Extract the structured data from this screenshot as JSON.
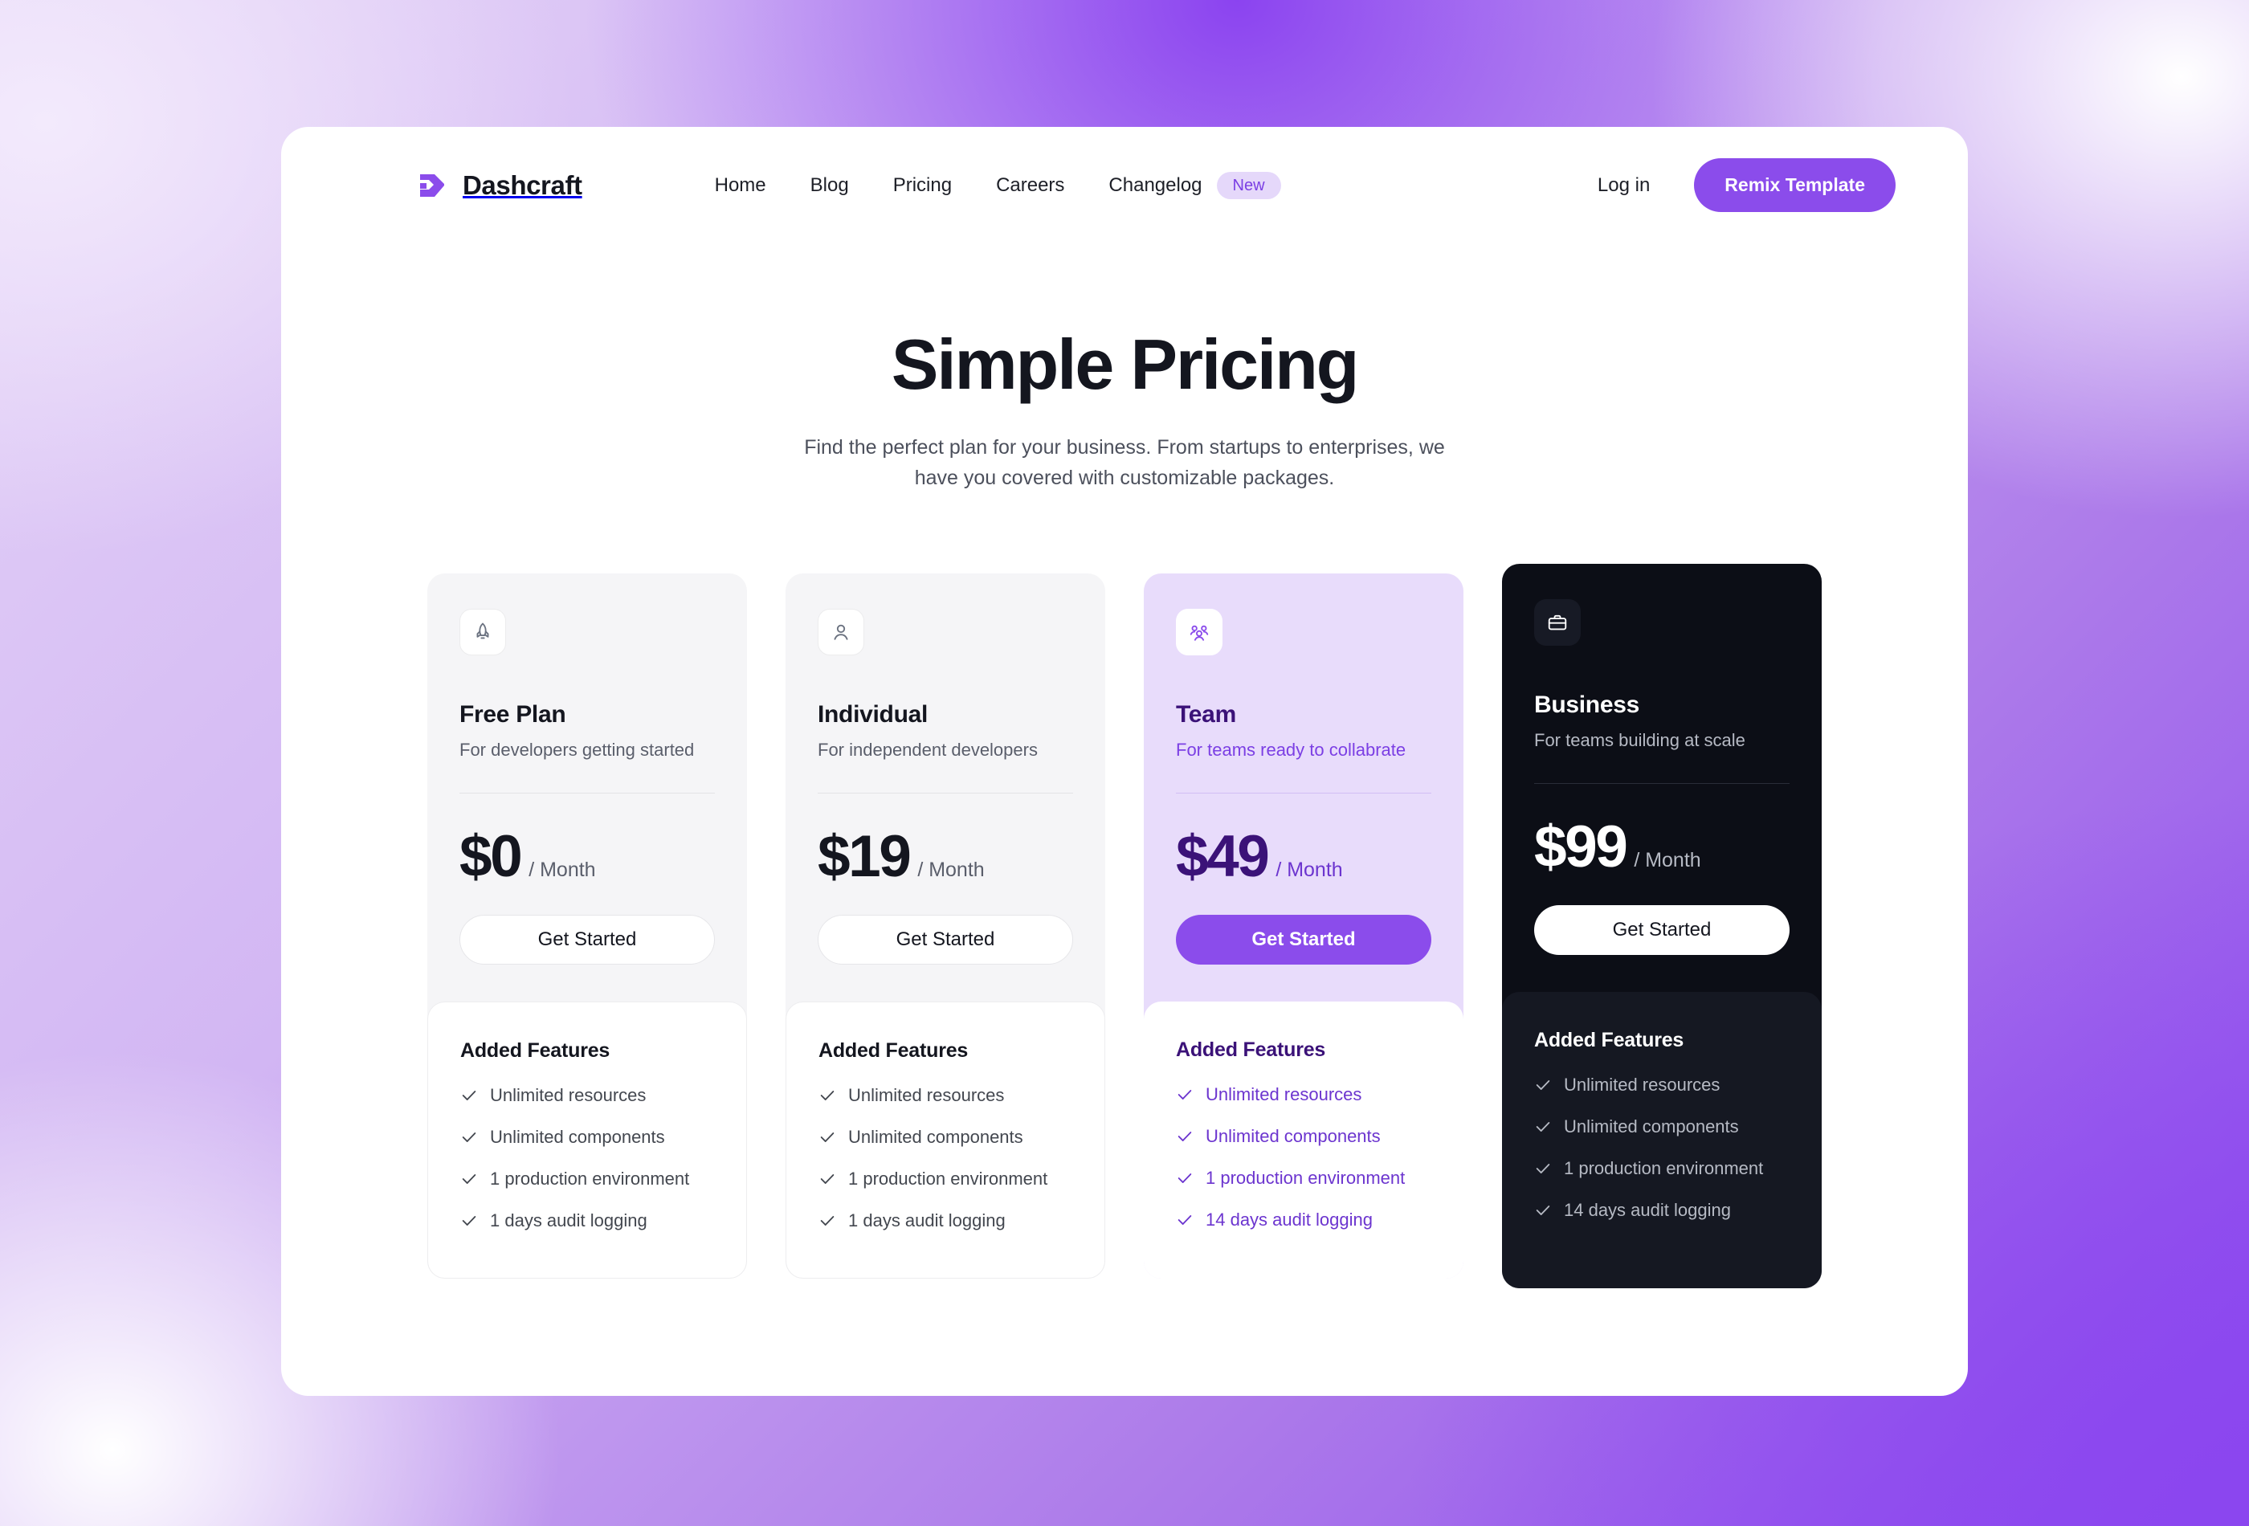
{
  "theme": {
    "brand_purple": "#8b4ceb",
    "accent_bg": "#e8dcfb",
    "dark_bg": "#0c0e16",
    "deep_purple_text": "#3b1278"
  },
  "navbar": {
    "logo_icon": "dashcraft-logo-icon",
    "brand_name": "Dashcraft",
    "links": [
      {
        "label": "Home"
      },
      {
        "label": "Blog"
      },
      {
        "label": "Pricing"
      },
      {
        "label": "Careers"
      }
    ],
    "changelog": {
      "label": "Changelog",
      "badge": "New"
    },
    "login_label": "Log in",
    "cta_label": "Remix Template"
  },
  "hero": {
    "title": "Simple Pricing",
    "subtitle": "Find the perfect plan for your business. From startups to enterprises, we have you covered with customizable packages."
  },
  "pricing": {
    "features_heading": "Added Features",
    "cta_label": "Get Started",
    "period_label": "/ Month",
    "plans": [
      {
        "icon": "rocket-icon",
        "name": "Free Plan",
        "description": "For developers getting started",
        "price": "$0",
        "period": "/ Month",
        "cta": "Get Started",
        "features_heading": "Added Features",
        "features": [
          "Unlimited resources",
          "Unlimited components",
          "1 production environment",
          "1 days audit logging"
        ]
      },
      {
        "icon": "user-icon",
        "name": "Individual",
        "description": "For independent developers",
        "price": "$19",
        "period": "/ Month",
        "cta": "Get Started",
        "features_heading": "Added Features",
        "features": [
          "Unlimited resources",
          "Unlimited components",
          "1 production environment",
          "1 days audit logging"
        ]
      },
      {
        "icon": "users-group-icon",
        "name": "Team",
        "description": "For teams ready to collabrate",
        "price": "$49",
        "period": "/ Month",
        "cta": "Get Started",
        "features_heading": "Added Features",
        "features": [
          "Unlimited resources",
          "Unlimited components",
          "1 production environment",
          "14 days audit logging"
        ]
      },
      {
        "icon": "briefcase-icon",
        "name": "Business",
        "description": "For teams building at scale",
        "price": "$99",
        "period": "/ Month",
        "cta": "Get Started",
        "features_heading": "Added Features",
        "features": [
          "Unlimited resources",
          "Unlimited components",
          "1 production environment",
          "14 days audit logging"
        ]
      }
    ]
  }
}
